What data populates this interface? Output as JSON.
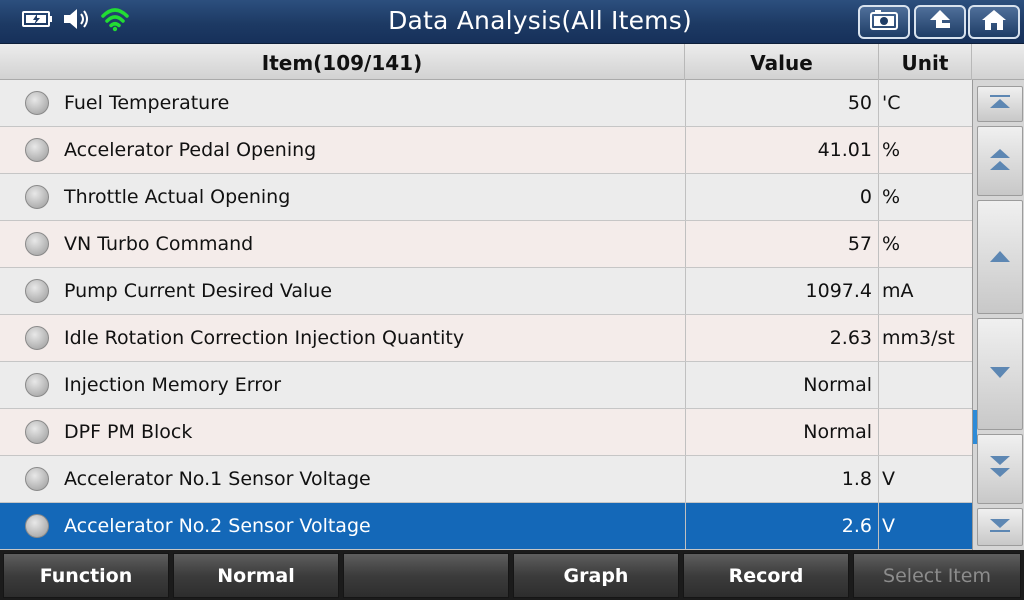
{
  "header": {
    "title": "Data Analysis(All Items)"
  },
  "table": {
    "headers": {
      "item": "Item(109/141)",
      "value": "Value",
      "unit": "Unit"
    },
    "rows": [
      {
        "item": "Fuel Temperature",
        "value": "50",
        "unit": "'C"
      },
      {
        "item": "Accelerator Pedal Opening",
        "value": "41.01",
        "unit": "%"
      },
      {
        "item": "Throttle Actual Opening",
        "value": "0",
        "unit": "%"
      },
      {
        "item": "VN Turbo Command",
        "value": "57",
        "unit": "%"
      },
      {
        "item": "Pump Current Desired Value",
        "value": "1097.4",
        "unit": "mA"
      },
      {
        "item": "Idle Rotation Correction Injection Quantity",
        "value": "2.63",
        "unit": "mm3/st"
      },
      {
        "item": "Injection Memory Error",
        "value": "Normal",
        "unit": ""
      },
      {
        "item": "DPF PM Block",
        "value": "Normal",
        "unit": ""
      },
      {
        "item": "Accelerator No.1 Sensor Voltage",
        "value": "1.8",
        "unit": "V"
      },
      {
        "item": "Accelerator No.2 Sensor Voltage",
        "value": "2.6",
        "unit": "V"
      }
    ]
  },
  "bottom_bar": {
    "function": "Function",
    "normal": "Normal",
    "blank": "",
    "graph": "Graph",
    "record": "Record",
    "select_item": "Select Item"
  },
  "colors": {
    "title_bar": "#1d3a64",
    "selected_row": "#1468b8",
    "wifi": "#22dd33"
  }
}
